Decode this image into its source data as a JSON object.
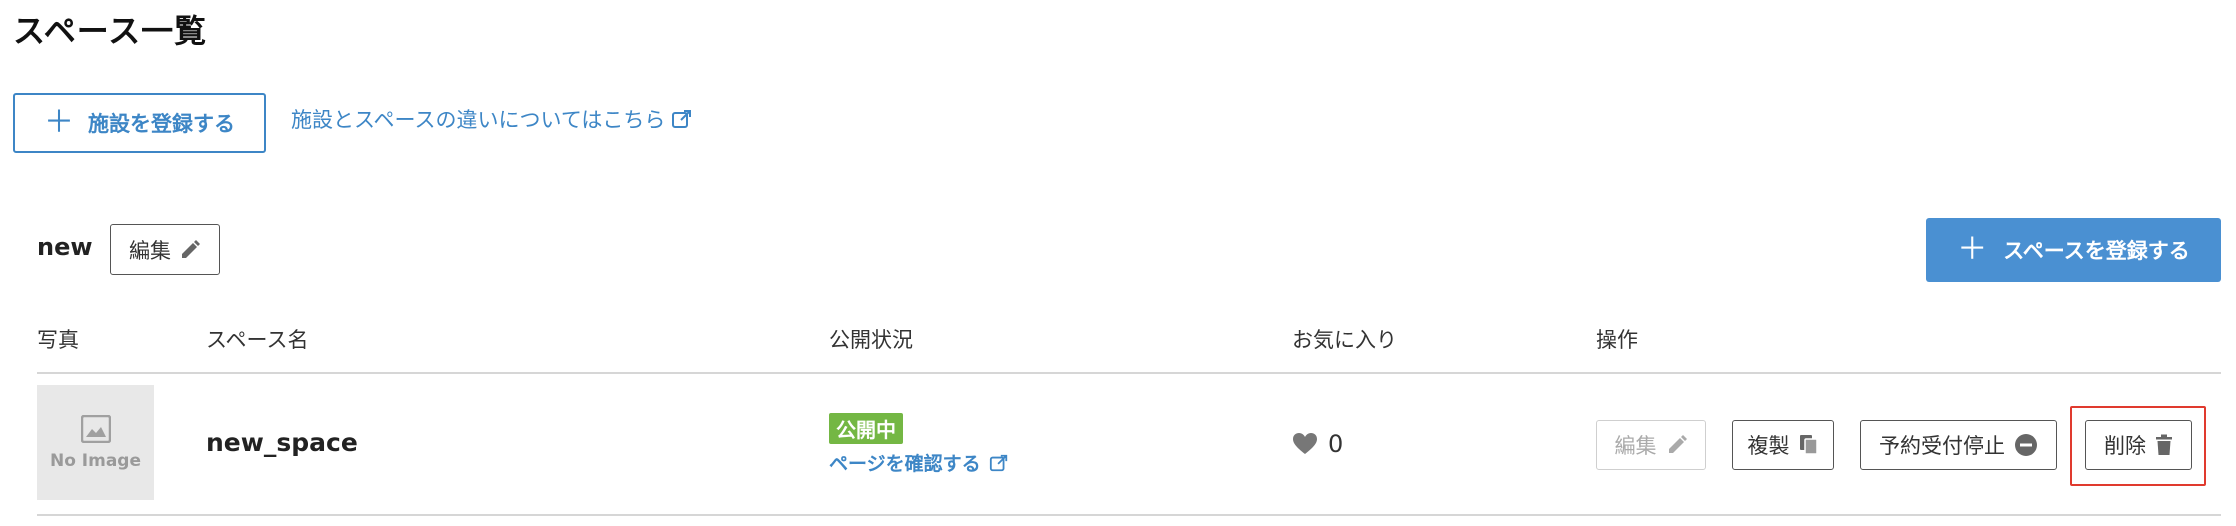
{
  "page": {
    "title": "スペース一覧"
  },
  "actions": {
    "register_facility_plus": "＋",
    "register_facility_label": "施設を登録する",
    "info_link_label": "施設とスペースの違いについてはこちら"
  },
  "group": {
    "name": "new",
    "edit_label": "編集",
    "register_space_plus": "＋",
    "register_space_label": "スペースを登録する"
  },
  "table": {
    "headers": {
      "photo": "写真",
      "space_name": "スペース名",
      "status": "公開状況",
      "favorites": "お気に入り",
      "operations": "操作"
    },
    "rows": [
      {
        "no_image": "No Image",
        "space_name": "new_space",
        "status_badge": "公開中",
        "page_link": "ページを確認する",
        "favorites_count": "0",
        "ops": {
          "edit": "編集",
          "duplicate": "複製",
          "stop_reservations": "予約受付停止",
          "delete": "削除"
        }
      }
    ]
  },
  "colors": {
    "link_blue": "#3d86c6",
    "primary_button": "#4a90d2",
    "status_green": "#74b744",
    "highlight_red": "#e03a2e"
  },
  "icons": [
    "plus-icon",
    "external-link-icon",
    "pencil-icon",
    "image-placeholder-icon",
    "heart-icon",
    "copy-icon",
    "minus-circle-icon",
    "trash-icon"
  ]
}
